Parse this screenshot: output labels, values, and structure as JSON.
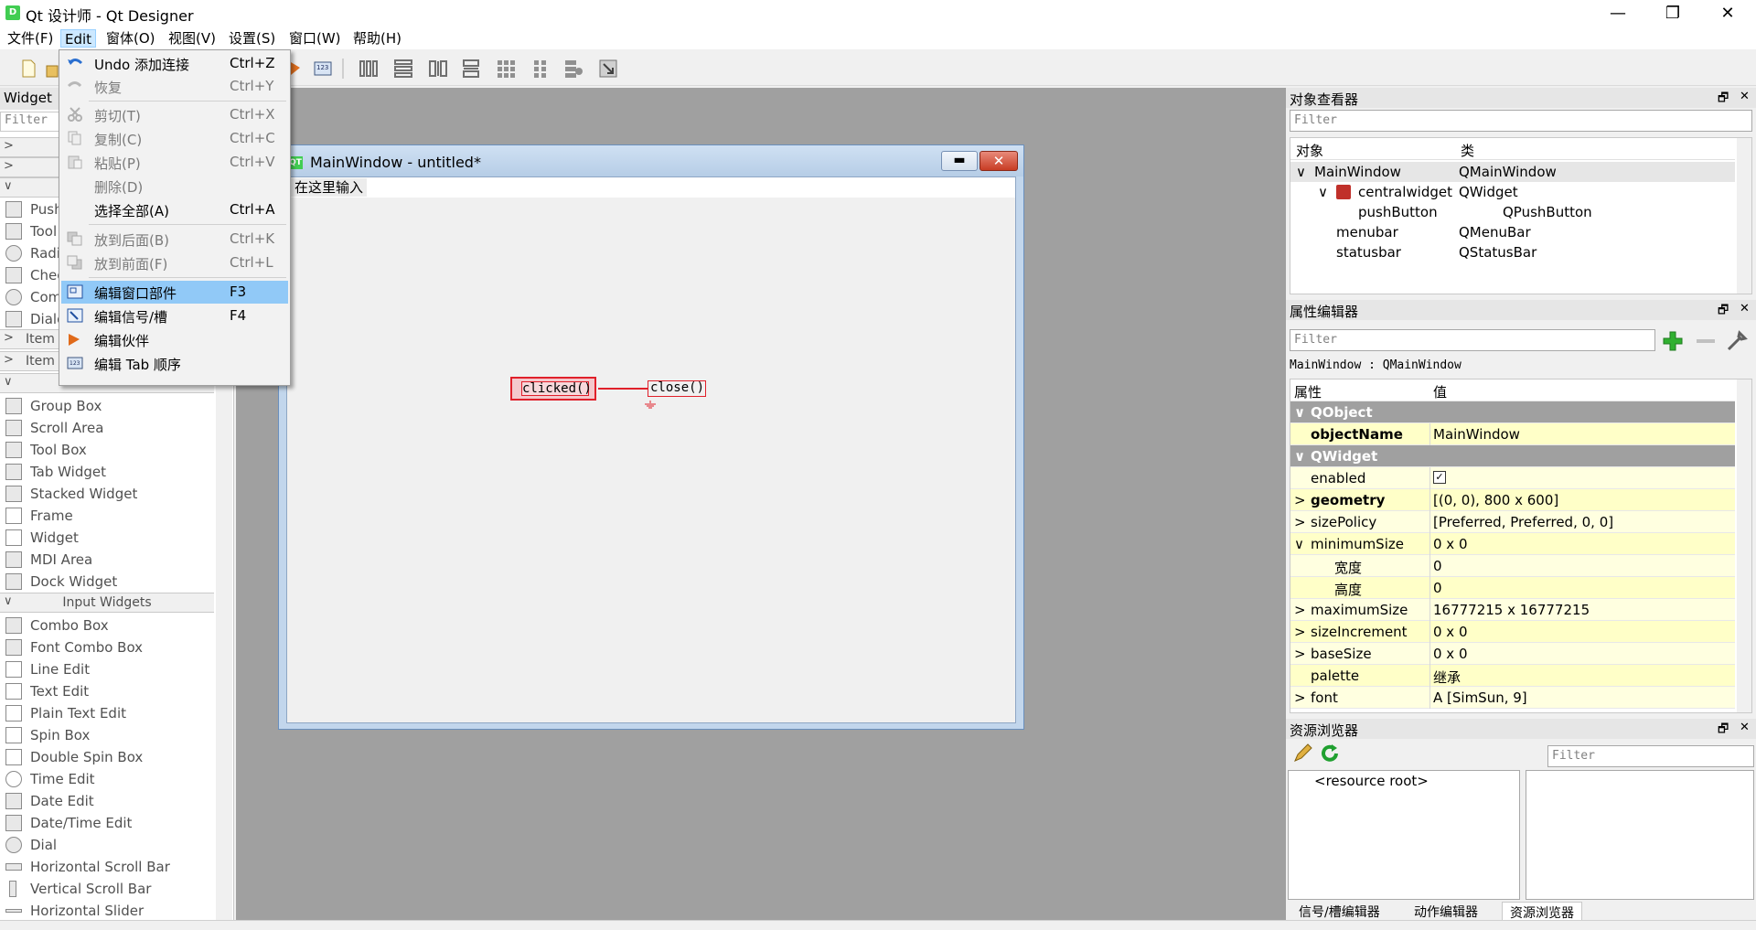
{
  "window": {
    "title": "Qt 设计师 - Qt Designer",
    "app_icon": "D",
    "minimize_glyph": "—",
    "maximize_glyph": "❐",
    "close_glyph": "✕"
  },
  "menubar": {
    "items": [
      "文件(F)",
      "Edit",
      "窗体(O)",
      "视图(V)",
      "设置(S)",
      "窗口(W)",
      "帮助(H)"
    ],
    "active": "Edit"
  },
  "edit_menu": {
    "items": [
      {
        "label": "Undo 添加连接",
        "shortcut": "Ctrl+Z",
        "enabled": true,
        "icon": "undo-icon"
      },
      {
        "label": "恢复",
        "shortcut": "Ctrl+Y",
        "enabled": false,
        "icon": "redo-icon"
      },
      {
        "label": "剪切(T)",
        "shortcut": "Ctrl+X",
        "enabled": false,
        "icon": "cut-icon"
      },
      {
        "label": "复制(C)",
        "shortcut": "Ctrl+C",
        "enabled": false,
        "icon": "copy-icon"
      },
      {
        "label": "粘贴(P)",
        "shortcut": "Ctrl+V",
        "enabled": false,
        "icon": "paste-icon"
      },
      {
        "label": "删除(D)",
        "shortcut": "",
        "enabled": false,
        "icon": ""
      },
      {
        "label": "选择全部(A)",
        "shortcut": "Ctrl+A",
        "enabled": true,
        "icon": ""
      },
      {
        "label": "放到后面(B)",
        "shortcut": "Ctrl+K",
        "enabled": false,
        "icon": "send-back-icon"
      },
      {
        "label": "放到前面(F)",
        "shortcut": "Ctrl+L",
        "enabled": false,
        "icon": "bring-front-icon"
      },
      {
        "label": "编辑窗口部件",
        "shortcut": "F3",
        "enabled": true,
        "icon": "edit-widgets-icon",
        "selected": true
      },
      {
        "label": "编辑信号/槽",
        "shortcut": "F4",
        "enabled": true,
        "icon": "edit-signals-icon"
      },
      {
        "label": "编辑伙伴",
        "shortcut": "",
        "enabled": true,
        "icon": "edit-buddies-icon"
      },
      {
        "label": "编辑 Tab 顺序",
        "shortcut": "",
        "enabled": true,
        "icon": "edit-tab-order-icon"
      }
    ]
  },
  "widget_box": {
    "title": "Widget",
    "filter_placeholder": "Filter",
    "collapsed_rows": [
      ">",
      ">"
    ],
    "peek_items": [
      "Push",
      "Tool",
      "Radi",
      "Chec",
      "Com",
      "Dialo"
    ],
    "item_rows": [
      "Item",
      "Item"
    ],
    "containers": [
      "Group Box",
      "Scroll Area",
      "Tool Box",
      "Tab Widget",
      "Stacked Widget",
      "Frame",
      "Widget",
      "MDI Area",
      "Dock Widget"
    ],
    "input_category": "Input Widgets",
    "inputs": [
      "Combo Box",
      "Font Combo Box",
      "Line Edit",
      "Text Edit",
      "Plain Text Edit",
      "Spin Box",
      "Double Spin Box",
      "Time Edit",
      "Date Edit",
      "Date/Time Edit",
      "Dial",
      "Horizontal Scroll Bar",
      "Vertical Scroll Bar",
      "Horizontal Slider"
    ]
  },
  "form": {
    "title": "MainWindow - untitled*",
    "icon": "QT",
    "menubar_placeholder": "在这里输入",
    "signal": "clicked()",
    "slot": "close()"
  },
  "object_inspector": {
    "title": "对象查看器",
    "filter_placeholder": "Filter",
    "col_object": "对象",
    "col_class": "类",
    "rows": [
      {
        "object": "MainWindow",
        "class": "QMainWindow"
      },
      {
        "object": "centralwidget",
        "class": "QWidget"
      },
      {
        "object": "pushButton",
        "class": "QPushButton"
      },
      {
        "object": "menubar",
        "class": "QMenuBar"
      },
      {
        "object": "statusbar",
        "class": "QStatusBar"
      }
    ]
  },
  "property_editor": {
    "title": "属性编辑器",
    "filter_placeholder": "Filter",
    "context": "MainWindow : QMainWindow",
    "col_property": "属性",
    "col_value": "值",
    "rows": [
      {
        "name": "QObject",
        "value": "",
        "group": true
      },
      {
        "name": "objectName",
        "value": "MainWindow",
        "bold": true
      },
      {
        "name": "QWidget",
        "value": "",
        "group": true
      },
      {
        "name": "enabled",
        "value": "✓"
      },
      {
        "name": "geometry",
        "value": "[(0, 0), 800 x 600]",
        "bold": true
      },
      {
        "name": "sizePolicy",
        "value": "[Preferred, Preferred, 0, 0]"
      },
      {
        "name": "minimumSize",
        "value": "0 x 0"
      },
      {
        "name": "宽度",
        "value": "0"
      },
      {
        "name": "高度",
        "value": "0"
      },
      {
        "name": "maximumSize",
        "value": "16777215 x 16777215"
      },
      {
        "name": "sizeIncrement",
        "value": "0 x 0"
      },
      {
        "name": "baseSize",
        "value": "0 x 0"
      },
      {
        "name": "palette",
        "value": "继承"
      },
      {
        "name": "font",
        "value": "A  [SimSun, 9]"
      }
    ]
  },
  "resource_browser": {
    "title": "资源浏览器",
    "filter_placeholder": "Filter",
    "root": "<resource root>"
  },
  "bottom_tabs": [
    "信号/槽编辑器",
    "动作编辑器",
    "资源浏览器"
  ],
  "active_bottom_tab": "资源浏览器",
  "colors": {
    "menu_selected": "#91c9f7",
    "connection_red": "#e0202a",
    "group_gray": "#a0a0a0",
    "property_yellow": "#ffffe0"
  }
}
